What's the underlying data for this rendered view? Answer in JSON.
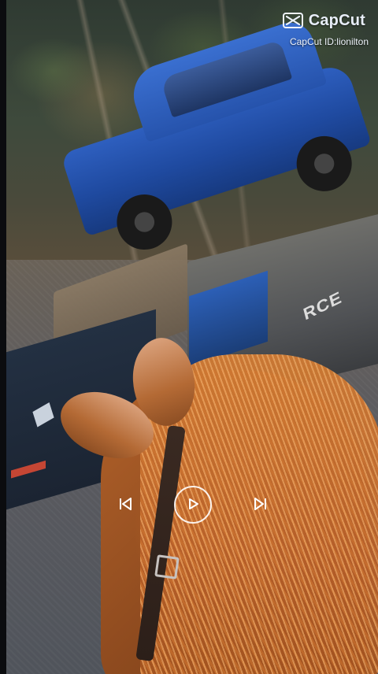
{
  "watermark": {
    "brand_name": "CapCut",
    "creator_id": "CapCut ID:lionilton",
    "icon": "capcut-logo-icon"
  },
  "player": {
    "previous_icon": "skip-previous-icon",
    "play_icon": "play-icon",
    "next_icon": "skip-next-icon"
  },
  "scene": {
    "trailer_logo": "RCE"
  },
  "colors": {
    "overlay_text": "#eef3fb",
    "control_stroke": "#ffffff",
    "truck_blue": "#2653ac",
    "horse_chestnut": "#b8602a"
  }
}
